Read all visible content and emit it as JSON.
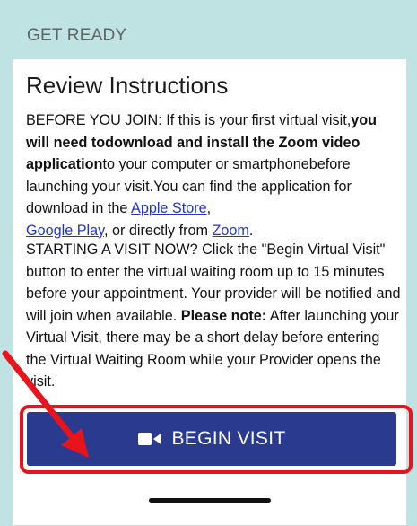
{
  "header": {
    "title": "GET READY"
  },
  "card": {
    "title": "Review Instructions",
    "para1": {
      "t1": "BEFORE YOU JOIN: If this is your first virtual visit,",
      "b1": "you will need todownload and install the Zoom video application",
      "t2": "to your computer or smartphonebefore launching your visit.You can find the application for download in the ",
      "link_apple": "Apple Store",
      "t3": ",",
      "link_google": "Google Play",
      "t4": ", or directly from ",
      "link_zoom": "Zoom",
      "t5": "."
    },
    "para2": {
      "t1": "STARTING A VISIT NOW? Click the \"Begin Virtual Visit\" button to enter the virtual waiting room up to 15 minutes before your appointment. Your provider will be notified and will join when available. ",
      "b1": "Please note:",
      "t2": " After launching your Virtual Visit, there may be a short delay before entering the Virtual Waiting Room while your Provider opens the visit."
    }
  },
  "begin_button": {
    "label": "BEGIN VISIT",
    "icon": "video-camera-icon"
  },
  "colors": {
    "header_bg": "#bfe2e3",
    "button_bg": "#2a3a8e",
    "link": "#2136c8",
    "highlight": "#e8141c"
  }
}
